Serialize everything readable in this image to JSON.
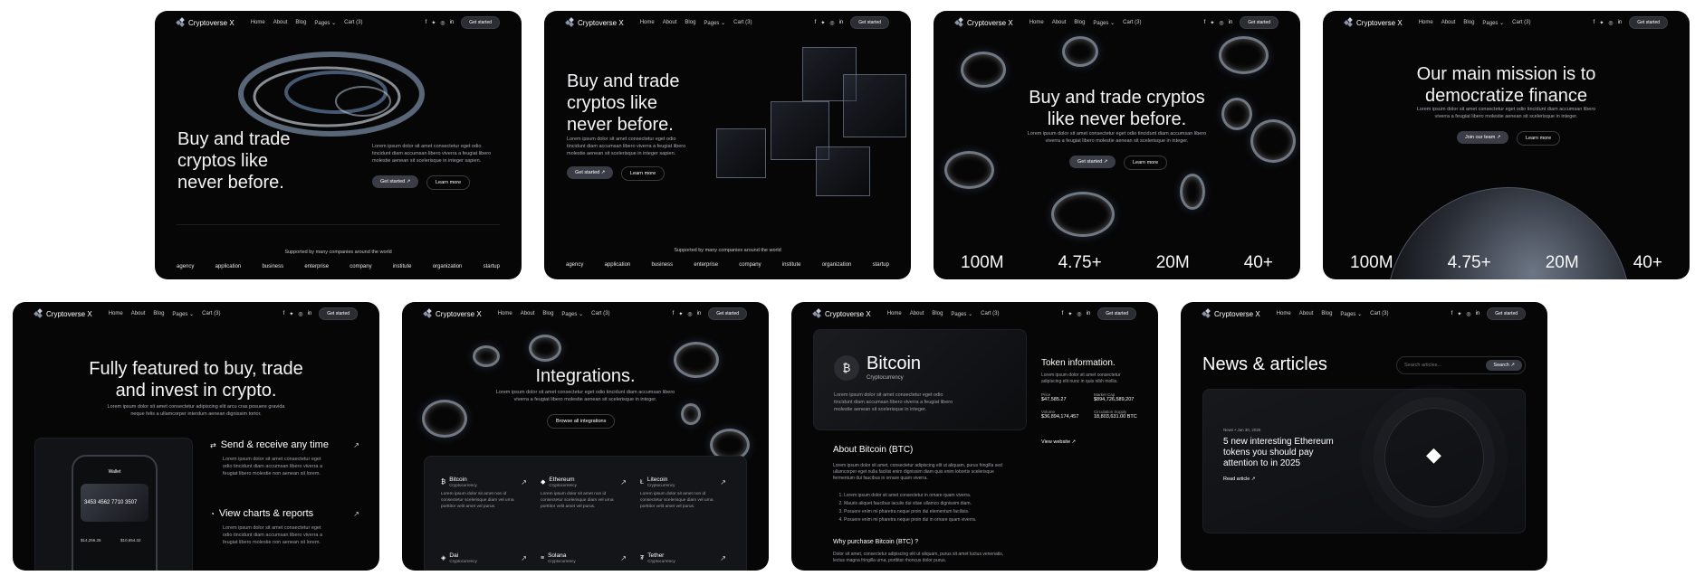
{
  "nav": {
    "brand": "Cryptoverse X",
    "links": [
      "Home",
      "About",
      "Blog",
      "Pages ⌄",
      "Cart (3)"
    ],
    "cta": "Get started"
  },
  "hero1": {
    "title_lines": [
      "Buy and trade",
      "cryptos like",
      "never before."
    ],
    "sub": "Lorem ipsum dolor sit amet consectetur eget odio tincidunt diam accumsan libero viverra a feugiat libero molestie aenean sit scelerisque in integer sapien.",
    "primary": "Get started ↗",
    "secondary": "Learn more",
    "supported": "Supported by many companies around the world",
    "logos": [
      "agency",
      "application",
      "business",
      "enterprise",
      "company",
      "institute",
      "organization",
      "startup"
    ]
  },
  "hero3": {
    "title_lines": [
      "Buy and trade cryptos",
      "like never before."
    ],
    "sub": "Lorem ipsum dolor sit amet consectetur eget odio tincidunt diam accumsan libero viverra a feugiat libero molestie aenean sit scelerisque in integer."
  },
  "hero4": {
    "title_lines": [
      "Our main mission is to",
      "democratize finance"
    ],
    "sub": "Lorem ipsum dolor sit amet consectetur eget odio tincidunt diam accumsan libero viverra a feugiat libero molestie aenean sit scelerisque in integer.",
    "primary": "Join our team ↗",
    "secondary": "Learn more"
  },
  "stats": [
    "100M",
    "4.75+",
    "20M",
    "40+"
  ],
  "hero5": {
    "title_lines": [
      "Fully featured to buy, trade",
      "and invest in crypto."
    ],
    "sub": "Lorem ipsum dolor sit amet consectetur adipiscing elit arcu cras posuere gravida neque felis a ullamcorper interdum aenean dignissim tortor.",
    "features": [
      {
        "title": "Send & receive any time",
        "body": "Lorem ipsum dolor sit amet consectetur eget odio tincidunt diam accumsan libero viverra a feugiat libero molestie non aenean sit lorem."
      },
      {
        "title": "View charts & reports",
        "body": "Lorem ipsum dolor sit amet consectetur eget odio tincidunt diam accumsan libero viverra a feugiat libero molestie non aenean sit lorem."
      }
    ],
    "phone_card": "3453 4562 7710 3507",
    "phone_header": "Wallet",
    "phone_values": [
      "$14,256.25",
      "$10,654.32"
    ]
  },
  "hero6": {
    "title": "Integrations.",
    "sub": "Lorem ipsum dolor sit amet consectetur eget odio tincidunt diam accumsan libero viverra a feugiat libero molestie aenean sit scelerisque in integer.",
    "button": "Browse all integrations",
    "coins": [
      {
        "name": "Bitcoin",
        "sub": "Cryptocurrency",
        "sym": "₿"
      },
      {
        "name": "Ethereum",
        "sub": "Cryptocurrency",
        "sym": "◆"
      },
      {
        "name": "Litecoin",
        "sub": "Cryptocurrency",
        "sym": "Ł"
      },
      {
        "name": "Dai",
        "sub": "Cryptocurrency",
        "sym": "◈"
      },
      {
        "name": "Solana",
        "sub": "Cryptocurrency",
        "sym": "≡"
      },
      {
        "name": "Tether",
        "sub": "Cryptocurrency",
        "sym": "₮"
      }
    ],
    "coin_body": "Lorem ipsum dolor sit amet non id consectetur scelerisque diam vel urna porttitor velit amet vel purus."
  },
  "hero7": {
    "coin": "Bitcoin",
    "coin_sub": "Cryptocurrency",
    "coin_desc": "Lorem ipsum dolor sit amet consectetur eget odio tincidunt diam accumsan libero viverra a feugiat libero molestie aenean sit scelerisque in integer.",
    "about_title": "About Bitcoin (BTC)",
    "about_body": "Lorem ipsum dolor sit amet, consectetur adipiscing elit ut aliquam, purus fringilla sed ullamcorper eget nulla facilisi enim dignissim diam quis enim lobortis scelerisque fermentum dui faucibus in ornare quam viverra.",
    "list": [
      "Lorem ipsum dolor sit amet consectetur in ornare quam viverra.",
      "Mauris aliquet faucibus iaculis dui vitae ullamco dignissim diam.",
      "Posuere enim mi pharetra neque proin dui elementum facilisis.",
      "Posuere enim mi pharetra neque proin dui in ornare quam viverra."
    ],
    "why_title": "Why purchase Bitcoin (BTC) ?",
    "why_body": "Dolor sit amet, consectetur adipiscing elit ut aliquam, purus sit amet luctus venenatis, lectus magna fringilla urna, porttitor rhoncus dolor purus.",
    "token_title": "Token information.",
    "token_sub": "Lorem ipsum dolor sit amet consectetur adipiscing elit nunc in quis nibh mollis.",
    "token_fields": [
      {
        "label": "Price",
        "value": "$47,585.27"
      },
      {
        "label": "Market Cap",
        "value": "$894,726,589,207"
      },
      {
        "label": "Volume",
        "value": "$36,894,174,457"
      },
      {
        "label": "Circulation Supply",
        "value": "18,803,631.00 BTC"
      }
    ],
    "view_site": "View website ↗"
  },
  "hero8": {
    "title": "News & articles",
    "search_placeholder": "Search articles...",
    "search_btn": "Search ↗",
    "article_meta": "News • Jan 30, 2025",
    "article_title_lines": [
      "5 new interesting Ethereum",
      "tokens you should pay",
      "attention to in 2025"
    ],
    "read": "Read article ↗"
  },
  "colors": {
    "card_bg": "#060607",
    "accent": "#3a3d45",
    "text": "#f4f4f6",
    "muted": "#a9abb3"
  }
}
